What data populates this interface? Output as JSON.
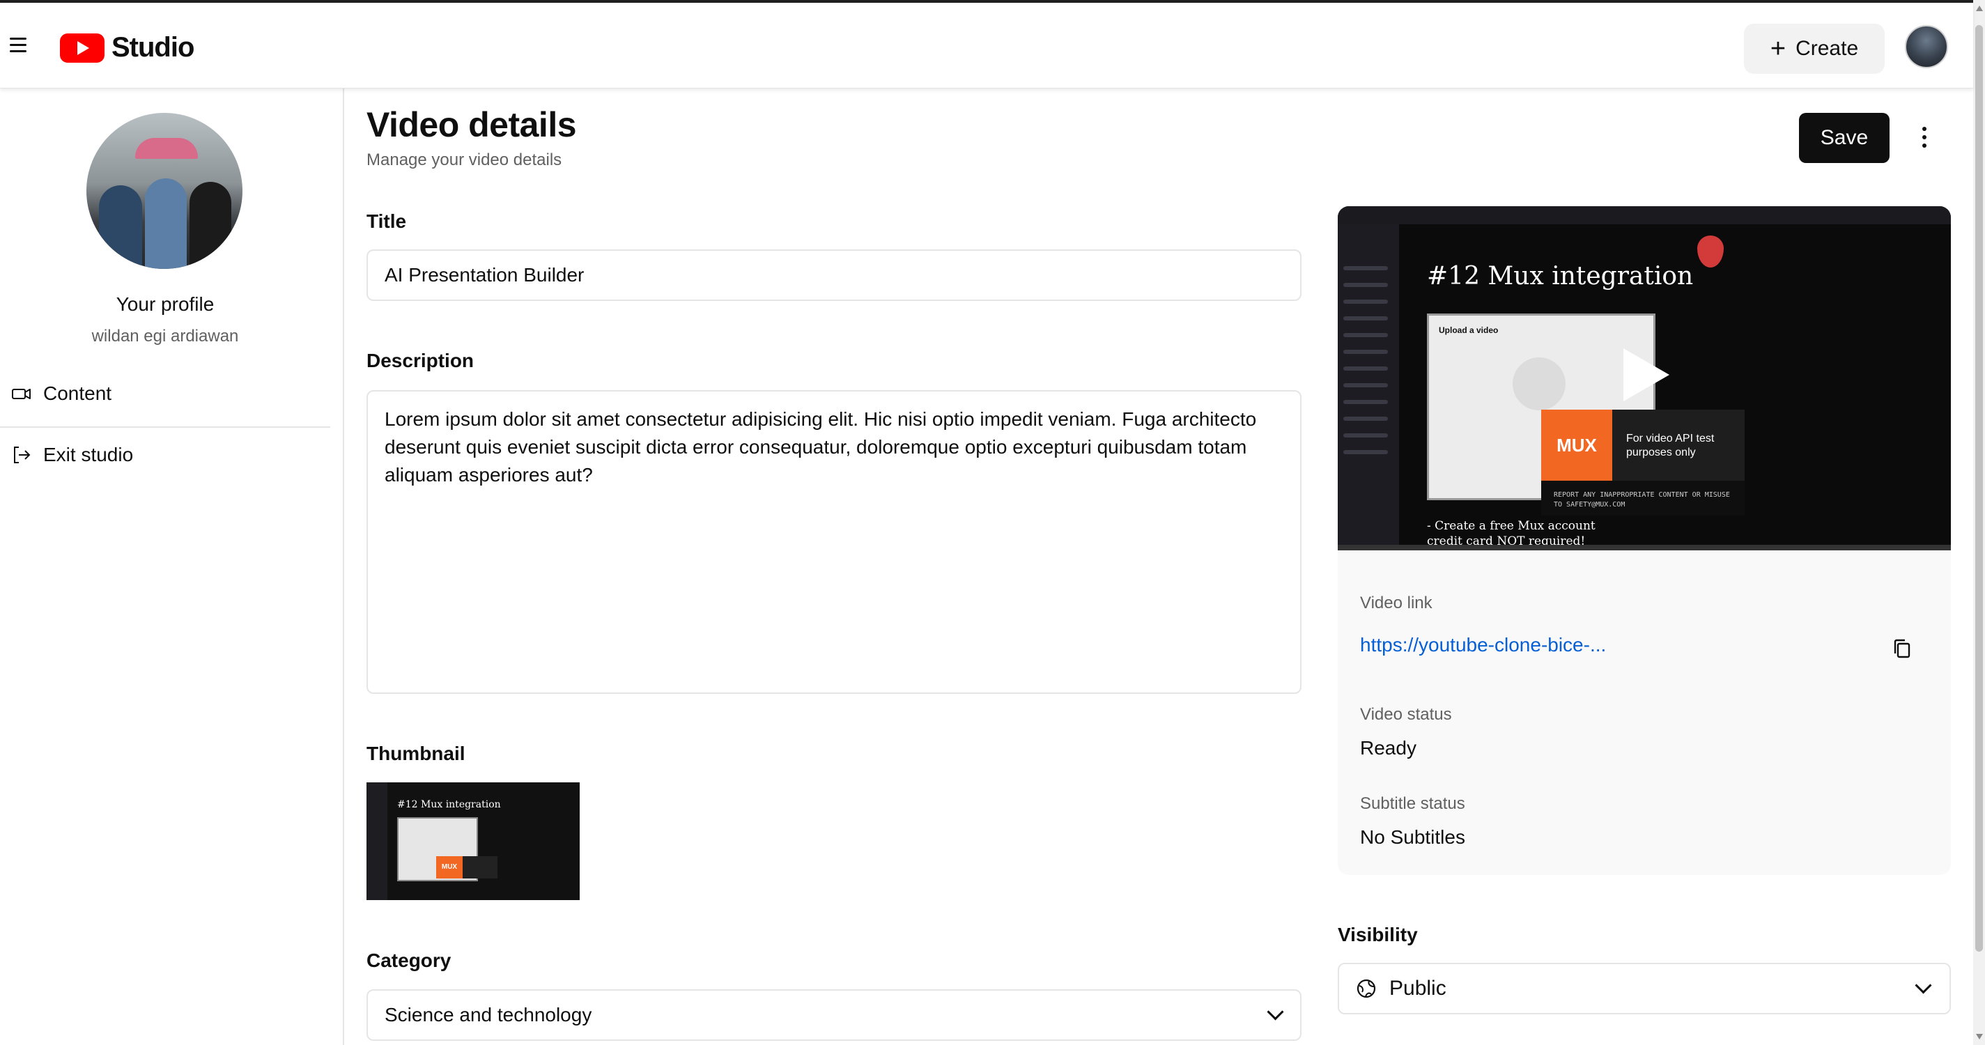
{
  "header": {
    "logo_text": "Studio",
    "create_label": "Create",
    "create_plus": "+"
  },
  "sidebar": {
    "profile_label": "Your profile",
    "profile_name": "wildan egi ardiawan",
    "items": [
      {
        "label": "Content",
        "icon": "video-icon"
      },
      {
        "label": "Exit studio",
        "icon": "logout-icon"
      }
    ]
  },
  "main": {
    "title": "Video details",
    "subtitle": "Manage your video details",
    "save_label": "Save",
    "title_label": "Title",
    "title_value": "AI Presentation Builder",
    "description_label": "Description",
    "description_value": "Lorem ipsum dolor sit amet consectetur adipisicing elit. Hic nisi optio impedit veniam. Fuga architecto deserunt quis eveniet suscipit dicta error consequatur, doloremque optio excepturi quibusdam totam aliquam asperiores aut?",
    "thumbnail_label": "Thumbnail",
    "category_label": "Category",
    "category_value": "Science and technology"
  },
  "video_panel": {
    "preview_title": "#12 Mux integration",
    "preview_dialog_title": "Upload a video",
    "preview_mux": "MUX",
    "preview_mux_note": "For video API test purposes only",
    "preview_mux_warning": "REPORT ANY INAPPROPRIATE CONTENT OR MISUSE TO SAFETY@MUX.COM",
    "preview_notes": "- Create a free Mux account",
    "preview_notes_2": "  credit card NOT required!",
    "video_link_label": "Video link",
    "video_link_value": "https://youtube-clone-bice-...",
    "video_status_label": "Video status",
    "video_status_value": "Ready",
    "subtitle_status_label": "Subtitle status",
    "subtitle_status_value": "No Subtitles",
    "visibility_label": "Visibility",
    "visibility_value": "Public"
  },
  "colors": {
    "brand": "#ff0000",
    "link": "#065fd4",
    "button_dark": "#0f0f0f",
    "mux_orange": "#f26722"
  }
}
